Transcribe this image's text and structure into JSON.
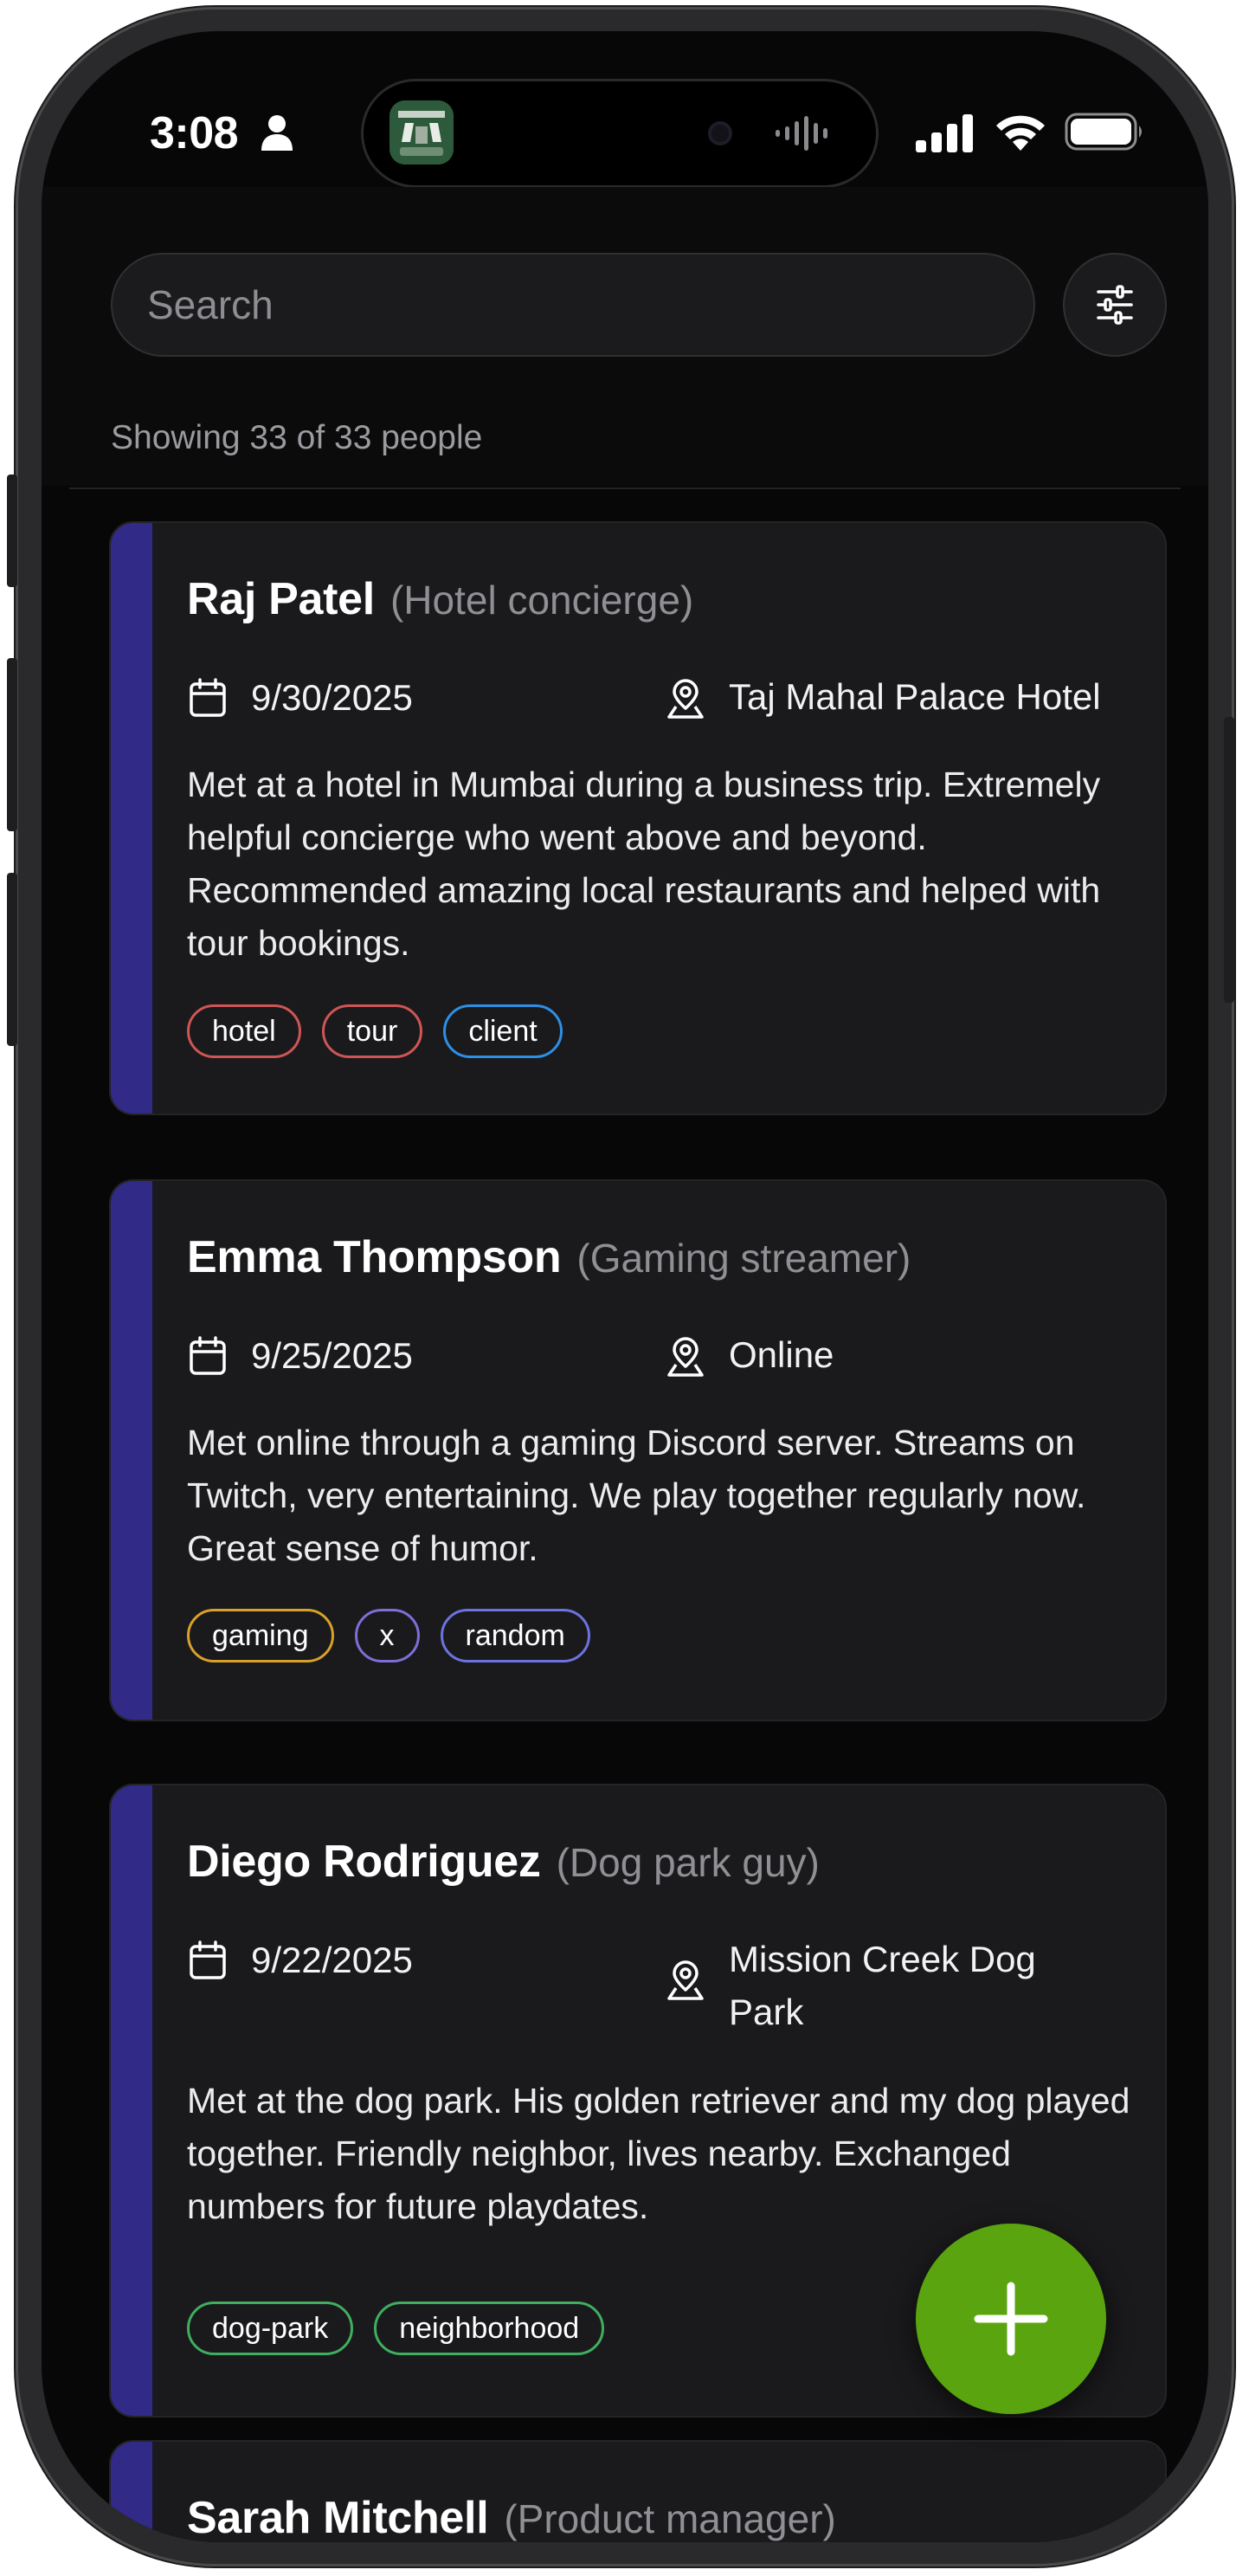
{
  "status_bar": {
    "time": "3:08",
    "icons": [
      "person-icon",
      "signal-icon",
      "wifi-icon",
      "battery-icon"
    ]
  },
  "search": {
    "placeholder": "Search",
    "value": "",
    "filter_icon": "sliders-icon"
  },
  "results_summary": "Showing 33 of 33 people",
  "colors": {
    "background": "#070707",
    "card": "#1a1a1c",
    "card_accent": "#312a87",
    "fab": "#5aa40f"
  },
  "cards": [
    {
      "name": "Raj Patel",
      "role": "(Hotel concierge)",
      "date": "9/30/2025",
      "location": "Taj Mahal Palace Hotel",
      "description": "Met at a hotel in Mumbai during a business trip. Extremely helpful concierge who went above and beyond. Recommended amazing local restaurants and helped with tour bookings.",
      "tags": [
        {
          "label": "hotel",
          "color": "#d05555"
        },
        {
          "label": "tour",
          "color": "#d05555"
        },
        {
          "label": "client",
          "color": "#2d8fe6"
        }
      ]
    },
    {
      "name": "Emma Thompson",
      "role": "(Gaming streamer)",
      "date": "9/25/2025",
      "location": "Online",
      "description": "Met online through a gaming Discord server. Streams on Twitch, very entertaining. We play together regularly now. Great sense of humor.",
      "tags": [
        {
          "label": "gaming",
          "color": "#d9a12a"
        },
        {
          "label": "x",
          "color": "#7c6fd8"
        },
        {
          "label": "random",
          "color": "#6c73e0"
        }
      ]
    },
    {
      "name": "Diego Rodriguez",
      "role": "(Dog park guy)",
      "date": "9/22/2025",
      "location": "Mission Creek Dog Park",
      "description": "Met at the dog park. His golden retriever and my dog played together. Friendly neighbor, lives nearby. Exchanged numbers for future playdates.",
      "tags": [
        {
          "label": "dog-park",
          "color": "#3fae5f"
        },
        {
          "label": "neighborhood",
          "color": "#3fae5f"
        }
      ]
    },
    {
      "name": "Sarah Mitchell",
      "role": "(Product manager)"
    }
  ],
  "fab": {
    "icon": "plus-icon"
  }
}
